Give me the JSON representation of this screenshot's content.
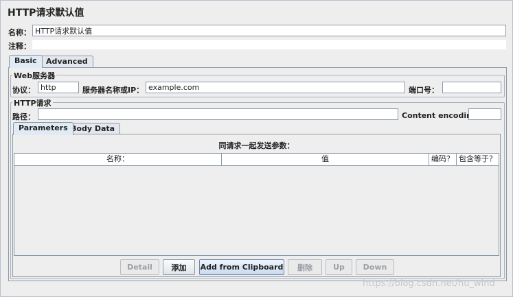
{
  "window": {
    "title": "HTTP请求默认值"
  },
  "fields": {
    "name_label": "名称：",
    "name_value": "HTTP请求默认值",
    "comment_label": "注释："
  },
  "tabs": [
    {
      "label": "Basic",
      "active": true
    },
    {
      "label": "Advanced",
      "active": false
    }
  ],
  "web_server": {
    "group_title": "Web服务器",
    "protocol_label": "协议：",
    "protocol_value": "http",
    "server_label": "服务器名称或IP：",
    "server_value": "example.com",
    "port_label": "端口号：",
    "port_value": ""
  },
  "http_request": {
    "group_title": "HTTP请求",
    "path_label": "路径：",
    "path_value": "",
    "encoding_label": "Content encoding:",
    "encoding_value": ""
  },
  "sub_tabs": [
    {
      "label": "Parameters",
      "active": true
    },
    {
      "label": "Body Data",
      "active": false
    }
  ],
  "params": {
    "caption": "同请求一起发送参数：",
    "columns": [
      "名称：",
      "值",
      "编码？",
      "包含等于？"
    ]
  },
  "buttons": {
    "detail": "Detail",
    "add": "添加",
    "add_clipboard": "Add from Clipboard",
    "delete": "删除",
    "up": "Up",
    "down": "Down"
  },
  "watermark": "https://blog.csdn.net/hu_wind"
}
